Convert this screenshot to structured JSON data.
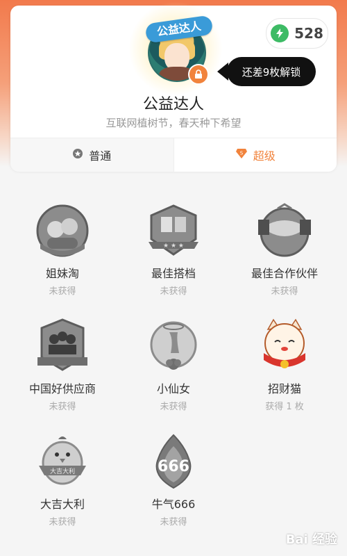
{
  "header": {
    "score": "528",
    "avatar_title": "公益达人",
    "tooltip": "还差9枚解锁",
    "badge_name": "公益达人",
    "badge_desc": "互联网植树节，春天种下希望"
  },
  "tabs": [
    {
      "label": "普通",
      "icon": "star-circle-icon",
      "active": false
    },
    {
      "label": "超级",
      "icon": "diamond-icon",
      "active": true
    }
  ],
  "medals": [
    {
      "name": "姐妹淘",
      "status": "未获得",
      "icon": "sisters-medal-icon"
    },
    {
      "name": "最佳搭档",
      "status": "未获得",
      "icon": "partner-medal-icon"
    },
    {
      "name": "最佳合作伙伴",
      "status": "未获得",
      "icon": "handshake-medal-icon"
    },
    {
      "name": "中国好供应商",
      "status": "未获得",
      "icon": "supplier-medal-icon"
    },
    {
      "name": "小仙女",
      "status": "未获得",
      "icon": "fairy-medal-icon"
    },
    {
      "name": "招财猫",
      "status": "获得 1 枚",
      "icon": "lucky-cat-medal-icon"
    },
    {
      "name": "大吉大利",
      "status": "未获得",
      "icon": "chicken-medal-icon"
    },
    {
      "name": "牛气666",
      "status": "未获得",
      "icon": "flame-666-medal-icon"
    }
  ],
  "watermark": "Bai 经验",
  "colors": {
    "accent": "#f1833c",
    "score_green": "#3dbb65",
    "tooltip_bg": "#111111",
    "avatar_label_bg": "#3a9bd8"
  }
}
